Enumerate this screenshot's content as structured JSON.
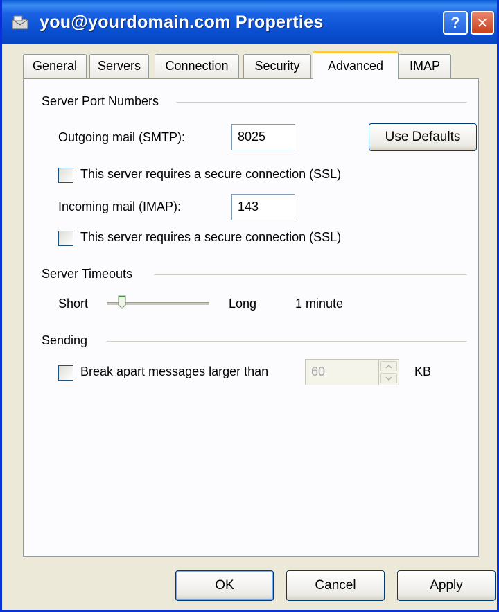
{
  "window": {
    "title": "you@yourdomain.com Properties",
    "help_glyph": "?",
    "close_glyph": "✕"
  },
  "tabs": [
    {
      "label": "General",
      "active": false
    },
    {
      "label": "Servers",
      "active": false
    },
    {
      "label": "Connection",
      "active": false
    },
    {
      "label": "Security",
      "active": false
    },
    {
      "label": "Advanced",
      "active": true
    },
    {
      "label": "IMAP",
      "active": false
    }
  ],
  "ports": {
    "group_label": "Server Port Numbers",
    "outgoing_label": "Outgoing mail (SMTP):",
    "outgoing_value": "8025",
    "use_defaults_label": "Use Defaults",
    "ssl_outgoing_label": "This server requires a secure connection (SSL)",
    "incoming_label": "Incoming mail (IMAP):",
    "incoming_value": "143",
    "ssl_incoming_label": "This server requires a secure connection (SSL)"
  },
  "timeouts": {
    "group_label": "Server Timeouts",
    "short_label": "Short",
    "long_label": "Long",
    "value_text": "1 minute"
  },
  "sending": {
    "group_label": "Sending",
    "break_apart_label": "Break apart messages larger than",
    "size_value": "60",
    "unit_label": "KB"
  },
  "footer": {
    "ok_label": "OK",
    "cancel_label": "Cancel",
    "apply_label": "Apply"
  }
}
